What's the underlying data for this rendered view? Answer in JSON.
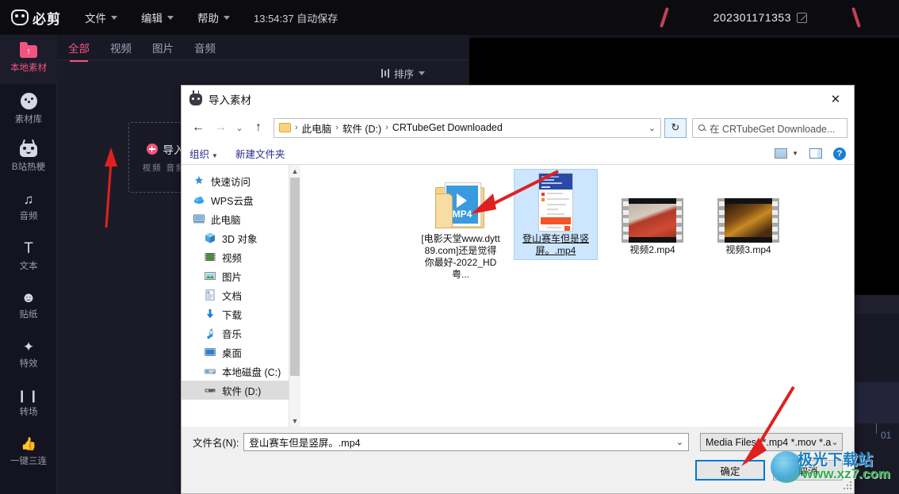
{
  "app": {
    "brand": "必剪",
    "menus": [
      {
        "label": "文件",
        "icon": "chevron-down-icon"
      },
      {
        "label": "编辑",
        "icon": "chevron-down-icon"
      },
      {
        "label": "帮助",
        "icon": "chevron-down-icon"
      }
    ],
    "autosave": "13:54:37 自动保存",
    "project_title": "202301171353",
    "edit_icon": "edit-icon",
    "accent_color": "#f0557f"
  },
  "sidebar": {
    "items": [
      {
        "label": "本地素材",
        "icon": "folder-upload-icon",
        "active": true
      },
      {
        "label": "素材库",
        "icon": "media-library-icon",
        "active": false
      },
      {
        "label": "B站热梗",
        "icon": "bilibili-tv-icon",
        "active": false
      },
      {
        "label": "音频",
        "icon": "music-note-icon",
        "active": false
      },
      {
        "label": "文本",
        "icon": "text-t-icon",
        "active": false
      },
      {
        "label": "贴纸",
        "icon": "sticker-face-icon",
        "active": false
      },
      {
        "label": "特效",
        "icon": "magic-wand-icon",
        "active": false
      },
      {
        "label": "转场",
        "icon": "transition-icon",
        "active": false
      },
      {
        "label": "一键三连",
        "icon": "thumbs-up-icon",
        "active": false
      }
    ]
  },
  "media_panel": {
    "tabs": [
      {
        "label": "全部",
        "active": true
      },
      {
        "label": "视频",
        "active": false
      },
      {
        "label": "图片",
        "active": false
      },
      {
        "label": "音频",
        "active": false
      }
    ],
    "sort": {
      "label": "排序",
      "icon": "sliders-icon",
      "caret": "chevron-down-icon"
    },
    "import": {
      "title": "导入素材",
      "subtitle": "视频 音频 图片",
      "plus_icon": "plus-circle-icon"
    }
  },
  "dialog": {
    "title": "导入素材",
    "title_icon": "bijian-app-icon",
    "close_icon": "close-icon",
    "nav": {
      "back_icon": "arrow-left-icon",
      "forward_icon": "arrow-right-icon",
      "history_icon": "chevron-down-icon",
      "up_icon": "arrow-up-icon",
      "refresh_icon": "refresh-icon",
      "folder_icon": "folder-icon",
      "breadcrumbs": [
        "此电脑",
        "软件 (D:)",
        "CRTubeGet Downloaded"
      ],
      "separator": "›",
      "dropdown_icon": "chevron-down-icon"
    },
    "search": {
      "placeholder": "在 CRTubeGet Downloade...",
      "icon": "search-icon"
    },
    "toolbar": {
      "organize": "组织",
      "new_folder": "新建文件夹",
      "view_icon": "view-layout-icon",
      "view_caret": "chevron-down-icon",
      "preview_pane_icon": "preview-pane-icon",
      "help_icon": "help-icon"
    },
    "tree": [
      {
        "label": "快速访问",
        "icon": "star-pin-icon",
        "indent": false,
        "selected": false
      },
      {
        "label": "WPS云盘",
        "icon": "cloud-icon",
        "indent": false,
        "selected": false
      },
      {
        "label": "此电脑",
        "icon": "computer-icon",
        "indent": false,
        "selected": false
      },
      {
        "label": "3D 对象",
        "icon": "cube-icon",
        "indent": true,
        "selected": false
      },
      {
        "label": "视频",
        "icon": "videos-folder-icon",
        "indent": true,
        "selected": false
      },
      {
        "label": "图片",
        "icon": "pictures-folder-icon",
        "indent": true,
        "selected": false
      },
      {
        "label": "文档",
        "icon": "documents-folder-icon",
        "indent": true,
        "selected": false
      },
      {
        "label": "下载",
        "icon": "downloads-icon",
        "indent": true,
        "selected": false
      },
      {
        "label": "音乐",
        "icon": "music-folder-icon",
        "indent": true,
        "selected": false
      },
      {
        "label": "桌面",
        "icon": "desktop-icon",
        "indent": true,
        "selected": false
      },
      {
        "label": "本地磁盘 (C:)",
        "icon": "drive-icon",
        "indent": true,
        "selected": false
      },
      {
        "label": "软件 (D:)",
        "icon": "drive-icon",
        "indent": true,
        "selected": true
      }
    ],
    "files": [
      {
        "name": "[电影天堂www.dytt89.com]还是觉得你最好-2022_HD粤...",
        "icon": "mp4-folder-icon",
        "selected": false
      },
      {
        "name": "登山赛车但是竖屏。.mp4",
        "icon": "phone-screenshot-thumb",
        "selected": true
      },
      {
        "name": "视频2.mp4",
        "icon": "film-thumb-red",
        "selected": false
      },
      {
        "name": "视频3.mp4",
        "icon": "film-thumb-gold",
        "selected": false
      }
    ],
    "footer": {
      "filename_label": "文件名(N):",
      "filename_value": "登山赛车但是竖屏。.mp4",
      "filetype_value": "Media Files (*.mp4 *.mov *.a",
      "confirm_button": "确定",
      "cancel_button": "取消"
    }
  },
  "timeline": {
    "time_label": "01"
  },
  "watermark": {
    "line1": "极光下载站",
    "line2": "www.xz7.com"
  }
}
